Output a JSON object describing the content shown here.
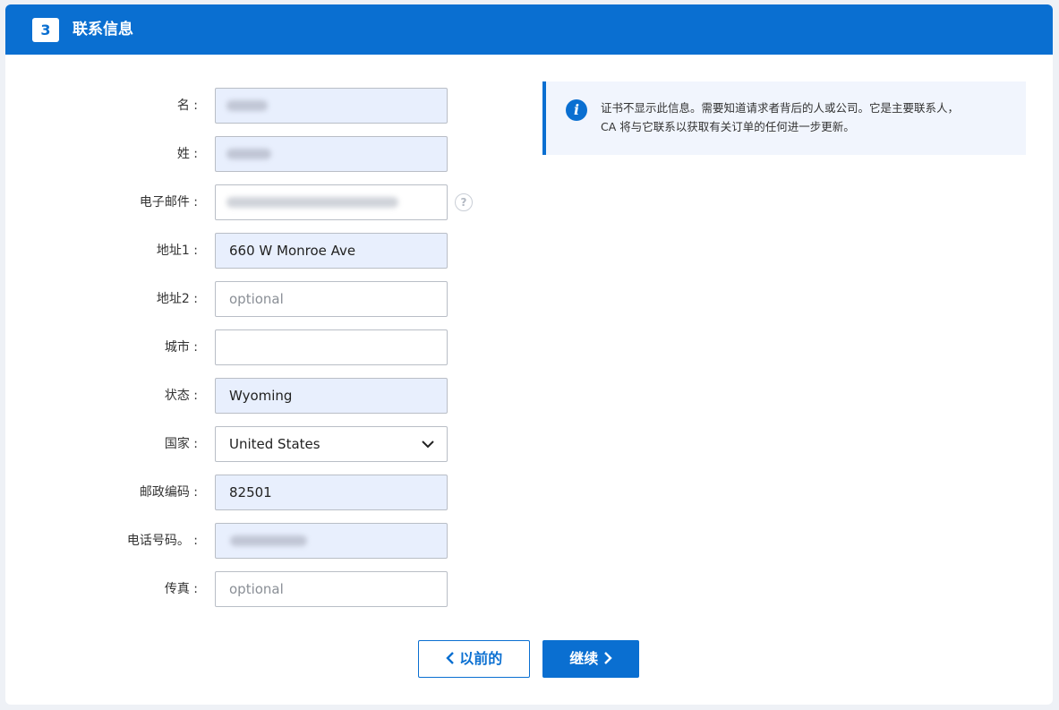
{
  "header": {
    "step_number": "3",
    "title": "联系信息"
  },
  "form": {
    "first_name": {
      "label": "名 :"
    },
    "last_name": {
      "label": "姓 :"
    },
    "email": {
      "label": "电子邮件 :",
      "help": "?"
    },
    "address1": {
      "label": "地址1 :",
      "value": "660 W Monroe Ave"
    },
    "address2": {
      "label": "地址2 :",
      "placeholder": "optional"
    },
    "city": {
      "label": "城市 :",
      "value": ""
    },
    "state": {
      "label": "状态 :",
      "value": "Wyoming"
    },
    "country": {
      "label": "国家 :",
      "selected": "United States"
    },
    "postal_code": {
      "label": "邮政编码 :",
      "value": "82501"
    },
    "phone": {
      "label": "电话号码。 :"
    },
    "fax": {
      "label": "传真 :",
      "placeholder": "optional"
    }
  },
  "info": {
    "icon": "info-icon",
    "line1": "证书不显示此信息。需要知道请求者背后的人或公司。它是主要联系人，",
    "line2": "CA 将与它联系以获取有关订单的任何进一步更新。"
  },
  "buttons": {
    "previous": "以前的",
    "next": "继续"
  },
  "colors": {
    "primary": "#0a6fd1",
    "filled_field": "#e8effd",
    "info_background": "#f1f5fd"
  }
}
